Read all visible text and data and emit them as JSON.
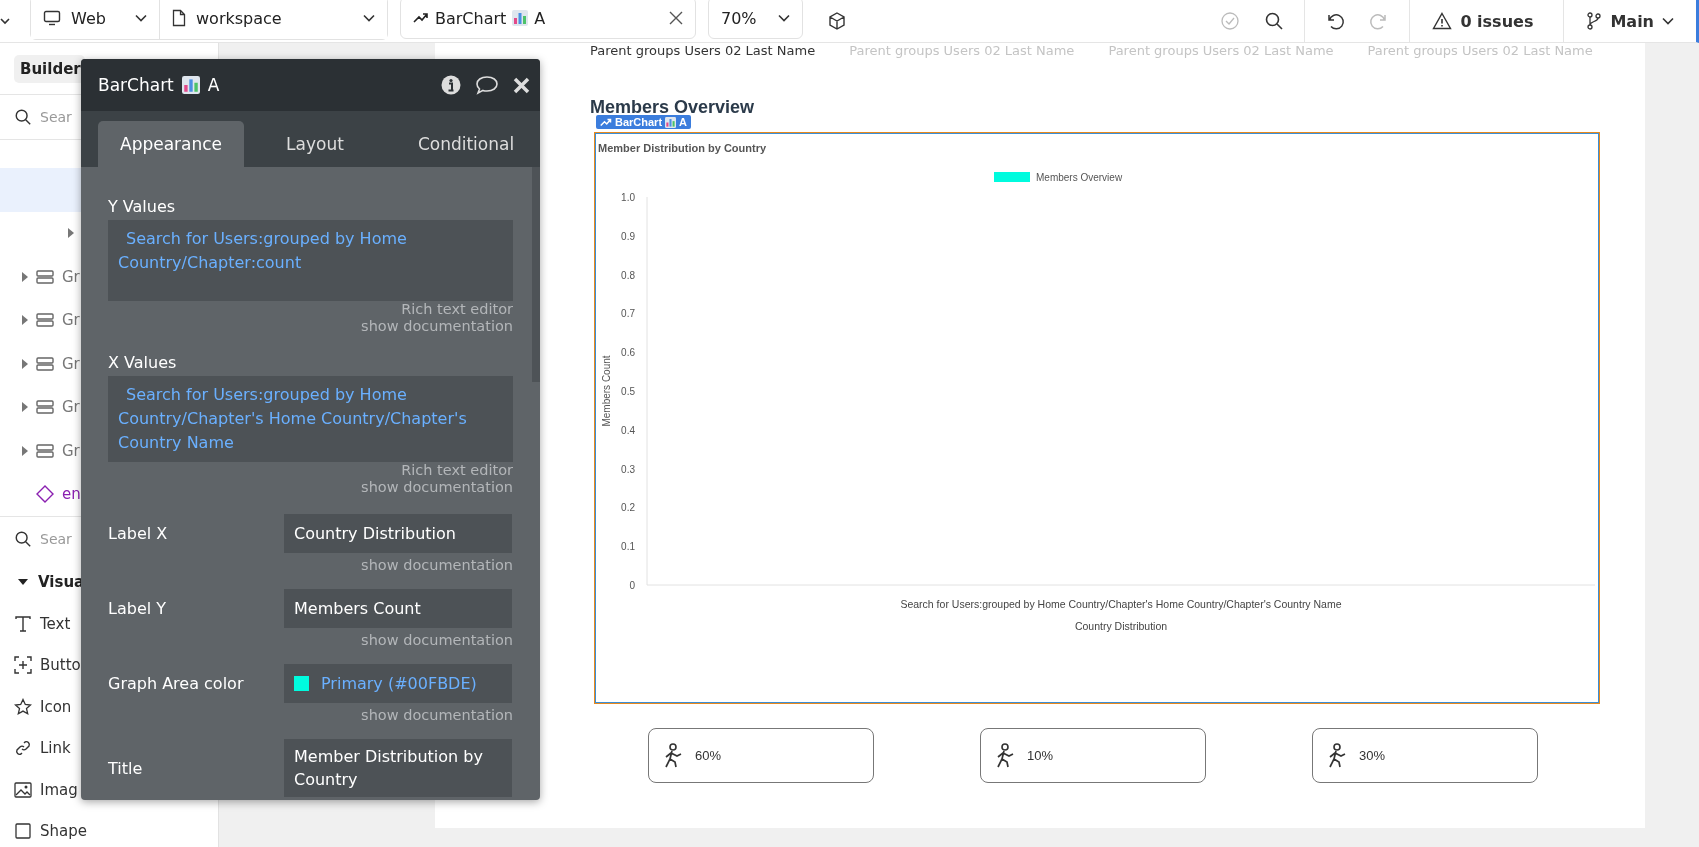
{
  "topbar": {
    "platform": "Web",
    "page": "workspace",
    "element": {
      "name": "BarChart",
      "suffix": "A"
    },
    "zoom": "70%",
    "issues": "0 issues",
    "branch": "Main"
  },
  "sidebar": {
    "tab": "Builder",
    "search_placeholder": "Sear",
    "tree": [
      {
        "selected": true,
        "kind": "blank"
      },
      {
        "selected": false,
        "kind": "collapsed"
      },
      {
        "label": "Gr",
        "selected": false,
        "kind": "group"
      },
      {
        "label": "Gr",
        "selected": false,
        "kind": "group"
      },
      {
        "label": "Gr",
        "selected": false,
        "kind": "group"
      },
      {
        "label": "Gr",
        "selected": false,
        "kind": "group"
      },
      {
        "label": "Gr",
        "selected": false,
        "kind": "group"
      },
      {
        "label": "en",
        "selected": false,
        "kind": "element"
      }
    ],
    "palette_search_placeholder": "Sear",
    "section": "Visua",
    "palette": [
      {
        "label": "Text",
        "kind": "text"
      },
      {
        "label": "Butto",
        "kind": "button"
      },
      {
        "label": "Icon",
        "kind": "star"
      },
      {
        "label": "Link",
        "kind": "link"
      },
      {
        "label": "Imag",
        "kind": "image"
      },
      {
        "label": "Shape",
        "kind": "shape"
      }
    ]
  },
  "panel": {
    "name": "BarChart",
    "suffix": "A",
    "tabs": [
      {
        "label": "Appearance",
        "selected": true
      },
      {
        "label": "Layout",
        "selected": false
      },
      {
        "label": "Conditional",
        "selected": false
      }
    ],
    "properties": [
      {
        "kind": "expression",
        "label": "Y Values",
        "value": "Search for Users:grouped by Home Country/Chapter:count",
        "note": "Rich text editor",
        "doc": "show documentation"
      },
      {
        "kind": "expression",
        "label": "X Values",
        "value": "Search for Users:grouped by Home Country/Chapter's Home Country/Chapter's Country Name",
        "note": "Rich text editor",
        "doc": "show documentation"
      },
      {
        "kind": "text",
        "label": "Label X",
        "value": "Country Distribution",
        "doc": "show documentation"
      },
      {
        "kind": "text",
        "label": "Label Y",
        "value": "Members Count",
        "doc": "show documentation"
      },
      {
        "kind": "color",
        "label": "Graph Area color",
        "value": "Primary (#00FBDE)",
        "color": "#00fbde",
        "doc": "show documentation"
      },
      {
        "kind": "text",
        "label": "Title",
        "value": "Member Distribution by Country"
      }
    ]
  },
  "canvas": {
    "tabs": [
      {
        "label": "Parent groups Users 02 Last Name",
        "selected": true
      },
      {
        "label": "Parent groups Users 02 Last Name",
        "selected": false
      },
      {
        "label": "Parent groups Users 02 Last Name",
        "selected": false
      },
      {
        "label": "Parent groups Users 02 Last Name",
        "selected": false
      }
    ],
    "heading": "Members Overview",
    "badge": {
      "name": "BarChart",
      "suffix": "A"
    },
    "chart_data": {
      "type": "bar",
      "title": "Member Distribution by Country",
      "xlabel": "Country Distribution",
      "ylabel": "Members Count",
      "categories": [
        "Search for Users:grouped by Home Country/Chapter's Home Country/Chapter's Country Name"
      ],
      "series": [
        {
          "name": "Members Overview",
          "color": "#00fbde",
          "values": [
            null
          ]
        }
      ],
      "ylim": [
        0,
        1
      ],
      "yticks": [
        0,
        {
          "value": 0.1,
          "label": "0.1"
        },
        {
          "value": 0.2,
          "label": "0.2"
        },
        {
          "value": 0.3,
          "label": "0.3"
        },
        {
          "value": 0.4,
          "label": "0.4"
        },
        {
          "value": 0.5,
          "label": "0.5"
        },
        {
          "value": 0.6,
          "label": "0.6"
        },
        {
          "value": 0.7,
          "label": "0.7"
        },
        {
          "value": 0.8,
          "label": "0.8"
        },
        {
          "value": 0.9,
          "label": "0.9"
        },
        {
          "value": 1,
          "label": "1.0"
        }
      ]
    },
    "stats": [
      "60%",
      "10%",
      "30%"
    ]
  }
}
